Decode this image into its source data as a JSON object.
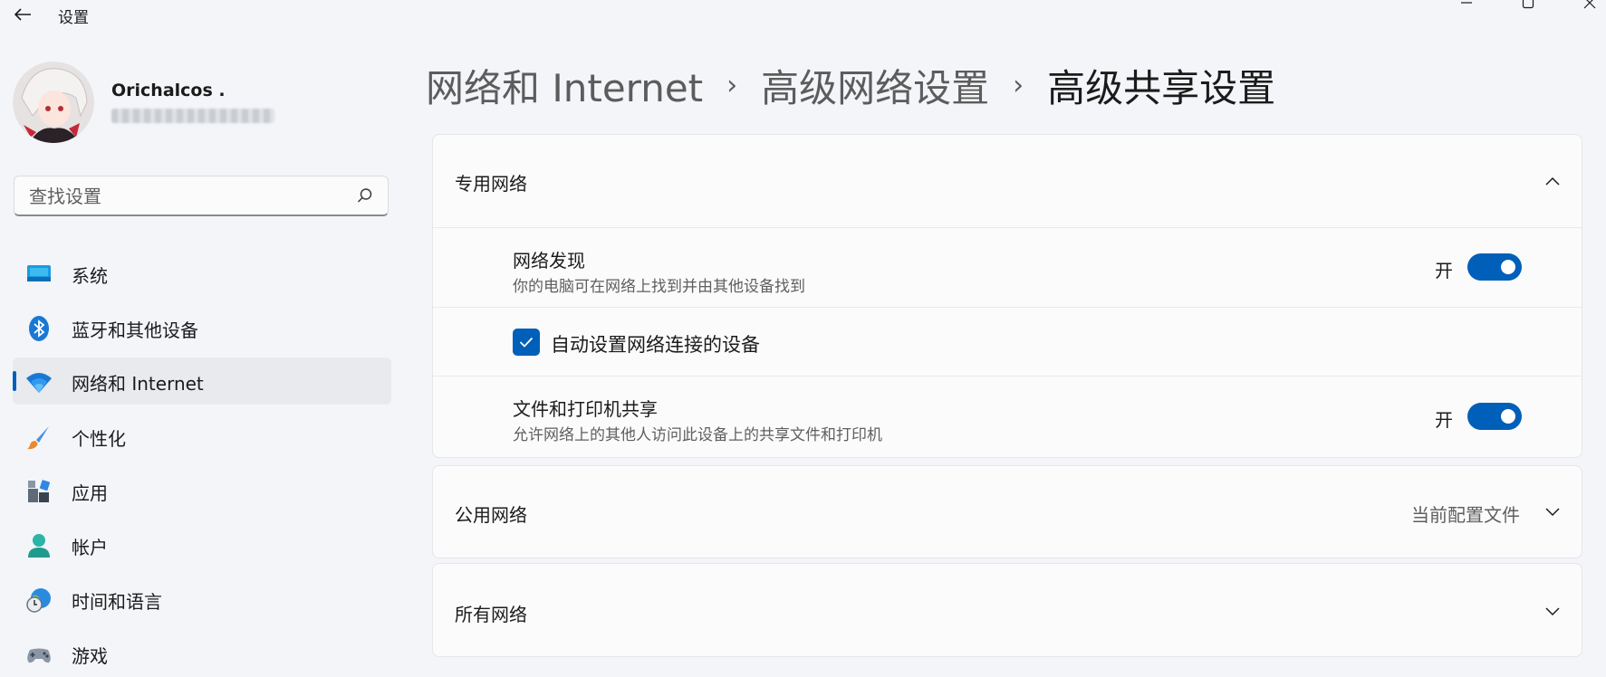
{
  "window": {
    "title": "设置"
  },
  "user": {
    "name": "Orichalcos .",
    "email": "••••••••••••••••••••"
  },
  "search": {
    "placeholder": "查找设置"
  },
  "sidebar": {
    "items": [
      {
        "label": "系统",
        "icon": "system-icon"
      },
      {
        "label": "蓝牙和其他设备",
        "icon": "bluetooth-icon"
      },
      {
        "label": "网络和 Internet",
        "icon": "wifi-icon",
        "active": true
      },
      {
        "label": "个性化",
        "icon": "brush-icon"
      },
      {
        "label": "应用",
        "icon": "apps-icon"
      },
      {
        "label": "帐户",
        "icon": "account-icon"
      },
      {
        "label": "时间和语言",
        "icon": "time-language-icon"
      },
      {
        "label": "游戏",
        "icon": "gaming-icon"
      }
    ]
  },
  "breadcrumb": [
    "网络和 Internet",
    "高级网络设置",
    "高级共享设置"
  ],
  "sections": {
    "private": {
      "title": "专用网络",
      "expanded": true,
      "network_discovery": {
        "title": "网络发现",
        "desc": "你的电脑可在网络上找到并由其他设备找到",
        "state": "开",
        "on": true
      },
      "auto_setup": {
        "label": "自动设置网络连接的设备",
        "checked": true
      },
      "file_printer_sharing": {
        "title": "文件和打印机共享",
        "desc": "允许网络上的其他人访问此设备上的共享文件和打印机",
        "state": "开",
        "on": true
      }
    },
    "public": {
      "title": "公用网络",
      "profile": "当前配置文件",
      "expanded": false
    },
    "all": {
      "title": "所有网络",
      "expanded": false
    }
  },
  "colors": {
    "accent": "#005fb8",
    "background": "#f3f5f9",
    "card": "#fbfbfc"
  }
}
